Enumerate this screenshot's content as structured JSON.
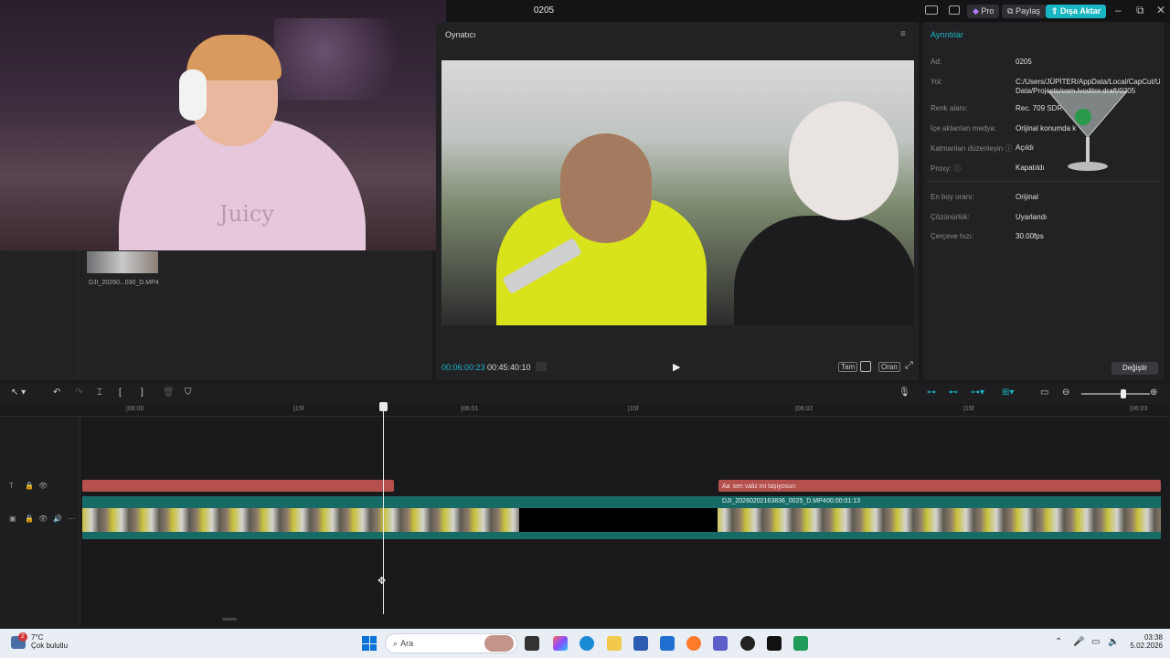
{
  "window": {
    "title": "0205",
    "pro": "Pro",
    "share": "Paylaş",
    "export": "Dışa Aktar",
    "minimize": "–",
    "maximize": "⧉",
    "close": "✕"
  },
  "camera": {
    "logo": "Juicy"
  },
  "player": {
    "label": "Oynatıcı",
    "timecode_current": "00:06:00:23",
    "timecode_total": "00:45:40:10",
    "btn_full": "Tam",
    "btn_ratio": "Oran"
  },
  "details": {
    "title": "Ayrıntılar",
    "rows": [
      {
        "label": "Ad:",
        "value": "0205"
      },
      {
        "label": "Yol:",
        "value": "C:/Users/JÜPİTER/AppData/Local/CapCut/User Data/Projects/com.lveditor.draft/0205"
      },
      {
        "label": "Renk alanı:",
        "value": "Rec. 709 SDR"
      },
      {
        "label": "İçe aktarılan medya:",
        "value": "Orijinal konumda k"
      },
      {
        "label": "Katmanları düzenleyin ⓘ",
        "value": "Açıldı"
      },
      {
        "label": "Proxy: ⓘ",
        "value": "Kapatıldı"
      },
      {
        "label": "En boy oranı:",
        "value": "Orijinal"
      },
      {
        "label": "Çözünürlük:",
        "value": "Uyarlandı"
      },
      {
        "label": "Çerçeve hızı:",
        "value": "30.00fps"
      }
    ],
    "change_button": "Değiştir"
  },
  "media": {
    "thumb_label": "DJI_20260...030_D.MP4"
  },
  "ruler": {
    "ticks": [
      "|06:00",
      "|15f",
      "|06:01",
      "|15f",
      "|06:02",
      "|15f",
      "|06:03"
    ]
  },
  "timeline": {
    "text_clip_label": "sen valiz mi taşıyosun",
    "text_clip_prefix": "Aa",
    "video_clip_label": "DJI_20260202163836_0025_D.MP4",
    "video_clip_duration": "00:00:01:13"
  },
  "taskbar": {
    "temp": "7°C",
    "weather": "Çok bulutlu",
    "badge": "2",
    "search": "Ara",
    "time": "03:38",
    "date": "5.02.2026"
  },
  "colors": {
    "accent": "#19b7c4",
    "text_clip": "#b5504d",
    "video_clip": "#176b66"
  }
}
